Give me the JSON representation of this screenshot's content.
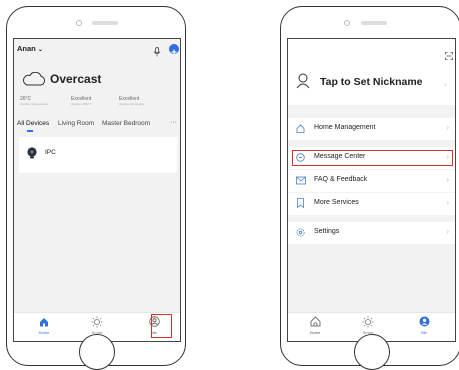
{
  "left_screen": {
    "home_name": "Anan",
    "weather": {
      "condition": "Overcast",
      "temperature": "26°C",
      "temperature_label": "Outdoor Temperature",
      "pm25": "Excellent",
      "pm25_label": "Outdoor PM2.5",
      "air_quality": "Excellent",
      "air_quality_label": "Outdoor Air Quality"
    },
    "room_tabs": [
      "All Devices",
      "Living Room",
      "Master Bedroom"
    ],
    "more_label": "···",
    "devices": [
      {
        "name": "IPC"
      }
    ],
    "tabbar": [
      {
        "label": "Home",
        "active": true
      },
      {
        "label": "Smart",
        "active": false
      },
      {
        "label": "Me",
        "active": false
      }
    ]
  },
  "right_screen": {
    "nickname_prompt": "Tap to Set Nickname",
    "menu_groups": [
      [
        "Home Management"
      ],
      [
        "Message Center",
        "FAQ & Feedback",
        "More Services"
      ],
      [
        "Settings"
      ]
    ],
    "tabbar": [
      {
        "label": "Home",
        "active": false
      },
      {
        "label": "Smart",
        "active": false
      },
      {
        "label": "Me",
        "active": true
      }
    ]
  },
  "colors": {
    "accent": "#2f6fe0",
    "highlight": "#d32f2f",
    "menu_icon": "#4a7ec9"
  }
}
